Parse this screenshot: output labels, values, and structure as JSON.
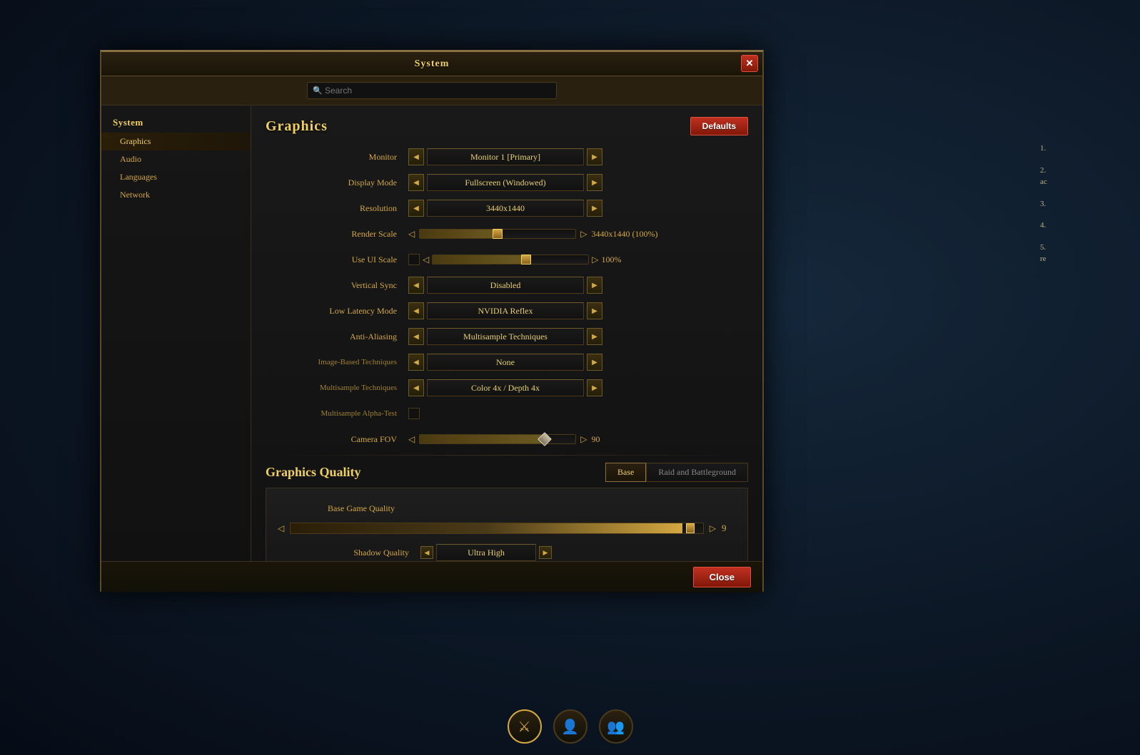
{
  "window": {
    "title": "System",
    "close_btn": "✕"
  },
  "search": {
    "placeholder": "Search"
  },
  "sidebar": {
    "system_label": "System",
    "items": [
      {
        "id": "graphics",
        "label": "Graphics",
        "active": true
      },
      {
        "id": "audio",
        "label": "Audio",
        "active": false
      },
      {
        "id": "languages",
        "label": "Languages",
        "active": false
      },
      {
        "id": "network",
        "label": "Network",
        "active": false
      }
    ]
  },
  "graphics": {
    "title": "Graphics",
    "defaults_btn": "Defaults",
    "settings": [
      {
        "id": "monitor",
        "label": "Monitor",
        "value": "Monitor 1 [Primary]"
      },
      {
        "id": "display_mode",
        "label": "Display Mode",
        "value": "Fullscreen (Windowed)"
      },
      {
        "id": "resolution",
        "label": "Resolution",
        "value": "3440x1440"
      },
      {
        "id": "render_scale",
        "label": "Render Scale",
        "value": "3440x1440 (100%)",
        "type": "slider",
        "fill_pct": 50
      },
      {
        "id": "use_ui_scale",
        "label": "Use UI Scale",
        "value": "100%",
        "type": "slider_checkbox",
        "fill_pct": 60
      },
      {
        "id": "vertical_sync",
        "label": "Vertical Sync",
        "value": "Disabled"
      },
      {
        "id": "low_latency_mode",
        "label": "Low Latency Mode",
        "value": "NVIDIA Reflex"
      },
      {
        "id": "anti_aliasing",
        "label": "Anti-Aliasing",
        "value": "Multisample Techniques"
      },
      {
        "id": "image_based",
        "label": "Image-Based Techniques",
        "value": "None",
        "sub": true
      },
      {
        "id": "multisample",
        "label": "Multisample Techniques",
        "value": "Color 4x / Depth 4x",
        "sub": true
      },
      {
        "id": "multisample_alpha",
        "label": "Multisample Alpha-Test",
        "type": "checkbox",
        "sub": true
      },
      {
        "id": "camera_fov",
        "label": "Camera FOV",
        "value": "90",
        "type": "slider_diamond",
        "fill_pct": 80
      }
    ]
  },
  "graphics_quality": {
    "title": "Graphics Quality",
    "tabs": [
      {
        "id": "base",
        "label": "Base",
        "active": true
      },
      {
        "id": "raid",
        "label": "Raid and Battleground",
        "active": false
      }
    ],
    "base_game_quality_label": "Base Game Quality",
    "quality_slider_value": "9",
    "shadow_quality_label": "Shadow Quality",
    "shadow_quality_value": "Ultra High"
  },
  "footer": {
    "close_btn": "Close"
  },
  "tips": [
    {
      "num": "1.",
      "text": ""
    },
    {
      "num": "2.",
      "text": "ac"
    },
    {
      "num": "3.",
      "text": ""
    },
    {
      "num": "4.",
      "text": ""
    },
    {
      "num": "5.",
      "text": "re"
    }
  ]
}
